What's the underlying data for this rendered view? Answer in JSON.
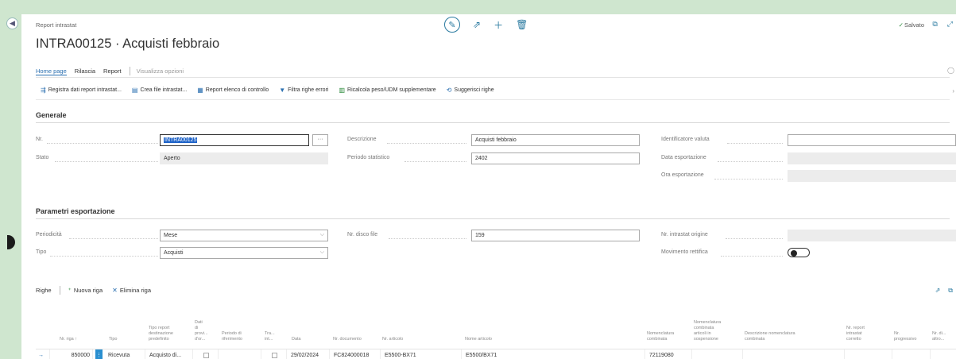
{
  "header": {
    "breadcrumb": "Report intrastat",
    "title": "INTRA00125 · Acquisti febbraio",
    "saved": "Salvato"
  },
  "tabs": {
    "home": "Home page",
    "release": "Rilascia",
    "report": "Report",
    "options": "Visualizza opzioni"
  },
  "actions": {
    "register": "Registra dati report intrastat...",
    "create_file": "Crea file intrastat...",
    "report_check": "Report elenco di controllo",
    "filter_errors": "Filtra righe errori",
    "recalc": "Ricalcola peso/UDM supplementare",
    "suggest": "Suggerisci righe"
  },
  "general": {
    "section": "Generale",
    "no_label": "Nr.",
    "no_value": "INTRA00125",
    "status_label": "Stato",
    "status_value": "Aperto",
    "desc_label": "Descrizione",
    "desc_value": "Acquisti febbraio",
    "period_label": "Periodo statistico",
    "period_value": "2402",
    "currency_label": "Identificatore valuta",
    "export_date_label": "Data esportazione",
    "export_time_label": "Ora esportazione"
  },
  "export": {
    "section": "Parametri esportazione",
    "periodicity_label": "Periodicità",
    "periodicity_value": "Mese",
    "type_label": "Tipo",
    "type_value": "Acquisti",
    "disk_label": "Nr. disco file",
    "disk_value": "159",
    "orig_label": "Nr. intrastat origine",
    "corrective_label": "Movimento rettifica"
  },
  "lines": {
    "title": "Righe",
    "new_line": "Nuova riga",
    "delete_line": "Elimina riga",
    "headers": {
      "line_no": "Nr. riga ↑",
      "type": "Tipo",
      "report_type": "Tipo report\ndestinazione\npredefinito",
      "data_prov": "Dati\ndi\nprovi...\nd'or...",
      "period_ref": "Periodo di\nriferimento",
      "trans": "Tra...\nint...",
      "date": "Data",
      "doc_no": "Nr. documento",
      "item_no": "Nr. articolo",
      "item_name": "Nome articolo",
      "tariff": "Nomenclatura\ncombinata",
      "tariff_sub": "Nomenclatura\ncombinata\narticoli in\nsospensione",
      "tariff_desc": "Descrizione nomenclatura\ncombinata",
      "corr_report": "Nr. report\nintrastat\ncorretto",
      "progressive": "Nr.\nprogressivo",
      "other": "Nr. di...\naltro..."
    },
    "row": {
      "line_no": "850000",
      "type": "Ricevuta",
      "report_type": "Acquisto di...",
      "date": "29/02/2024",
      "doc_no": "FC824000018",
      "item_no": "E5500-BX71",
      "item_name": "E5500/BX71",
      "tariff": "72119080"
    }
  }
}
